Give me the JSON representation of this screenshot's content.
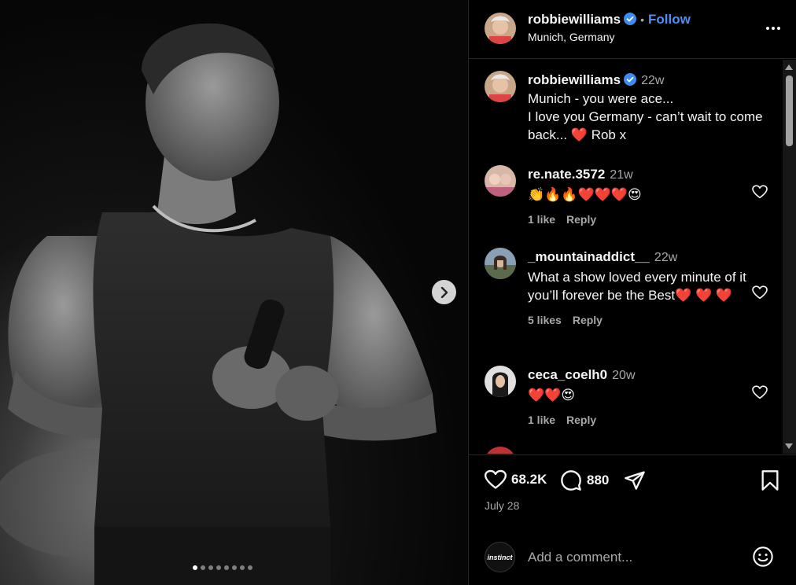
{
  "post": {
    "author": "robbiewilliams",
    "follow_label": "Follow",
    "location": "Munich, Germany",
    "image_count": 8,
    "active_image": 1
  },
  "caption": {
    "username": "robbiewilliams",
    "time": "22w",
    "text": "Munich - you were ace...\nI love you Germany - can’t wait to come back... ❤️ Rob x"
  },
  "comments": [
    {
      "username": "re.nate.3572",
      "time": "21w",
      "text": "👏🔥🔥❤️❤️❤️😍",
      "likes": "1 like",
      "reply": "Reply"
    },
    {
      "username": "_mountainaddict__",
      "time": "22w",
      "text": "What a show loved every minute of it you’ll forever be the Best❤️ ❤️ ❤️",
      "likes": "5 likes",
      "reply": "Reply"
    },
    {
      "username": "ceca_coelh0",
      "time": "20w",
      "text": "❤️❤️😍",
      "likes": "1 like",
      "reply": "Reply"
    }
  ],
  "actions": {
    "likes": "68.2K",
    "comments": "880",
    "date": "July 28"
  },
  "composer": {
    "placeholder": "Add a comment...",
    "avatar_text": "instinct"
  },
  "colors": {
    "accent": "#4d8ff5",
    "verified": "#3b8df0",
    "background": "#000000",
    "divider": "#262626"
  }
}
